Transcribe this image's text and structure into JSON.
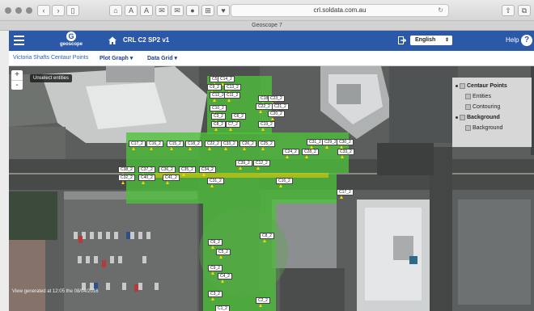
{
  "browser": {
    "url": "crl.soldata.com.au",
    "tab_title": "Geoscope 7",
    "toolbar_glyphs": [
      "⌂",
      "A",
      "A",
      "✉",
      "✉",
      "●",
      "⊞",
      "♥"
    ]
  },
  "header": {
    "logo_text": "geoscope",
    "title": "CRL C2 SP2 v1",
    "language": "English",
    "help_label": "Help",
    "help_glyph": "?"
  },
  "subnav": {
    "site_link": "Victoria Shafts Centaur Points",
    "plot_graph": "Plot Graph",
    "data_grid": "Data Grid"
  },
  "map": {
    "zoom_in": "+",
    "zoom_out": "-",
    "unselect_label": "Unselect entities",
    "generated_note": "View generated at 12:05 the 08/04/2016",
    "overlay_color": "#4dc23a",
    "layers": {
      "centaur_points": "Centaur Points",
      "entities": "Entities",
      "contouring": "Contouring",
      "background": "Background",
      "background_sub": "Background"
    },
    "markers": [
      {
        "label": "C5_2"
      },
      {
        "label": "C14_2"
      },
      {
        "label": "C9_2"
      },
      {
        "label": "C13_2"
      },
      {
        "label": "C12_2"
      },
      {
        "label": "C11_2"
      },
      {
        "label": "C10_2"
      },
      {
        "label": "C3_2"
      },
      {
        "label": "C6_2"
      },
      {
        "label": "C8_2"
      },
      {
        "label": "C7_2"
      },
      {
        "label": "C18_2"
      },
      {
        "label": "C23_2"
      },
      {
        "label": "C22_2"
      },
      {
        "label": "C21_2"
      },
      {
        "label": "C20_2"
      },
      {
        "label": "C19_2"
      },
      {
        "label": "C17_2"
      },
      {
        "label": "C16_2"
      },
      {
        "label": "C15_2"
      },
      {
        "label": "C18_2"
      },
      {
        "label": "C22_2"
      },
      {
        "label": "C33_2"
      },
      {
        "label": "C26_2"
      },
      {
        "label": "C25_2"
      },
      {
        "label": "C24_2"
      },
      {
        "label": "C28_2"
      },
      {
        "label": "C31_2"
      },
      {
        "label": "C29_2"
      },
      {
        "label": "C30_2"
      },
      {
        "label": "C33_2"
      },
      {
        "label": "C38_2"
      },
      {
        "label": "C37_2"
      },
      {
        "label": "C36_2"
      },
      {
        "label": "C35_2"
      },
      {
        "label": "C34_2"
      },
      {
        "label": "C32_2"
      },
      {
        "label": "C40_2"
      },
      {
        "label": "C41_2"
      },
      {
        "label": "C31_2"
      },
      {
        "label": "C39_2"
      },
      {
        "label": "C12_2"
      },
      {
        "label": "C16_2"
      },
      {
        "label": "C17_2"
      },
      {
        "label": "C8_2"
      },
      {
        "label": "C6_2"
      },
      {
        "label": "C5_2"
      },
      {
        "label": "C9_2"
      },
      {
        "label": "C4_2"
      },
      {
        "label": "C3_2"
      },
      {
        "label": "C2_2"
      },
      {
        "label": "C1_2"
      }
    ]
  }
}
